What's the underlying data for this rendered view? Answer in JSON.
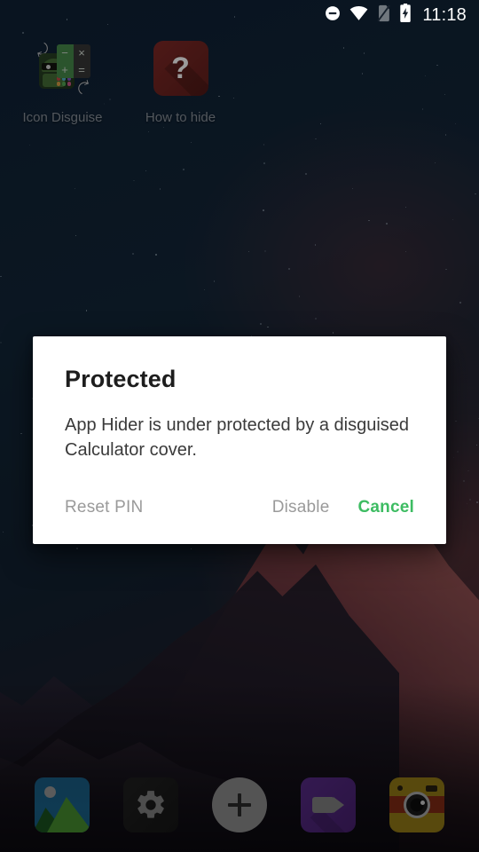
{
  "status_bar": {
    "icons": [
      {
        "name": "do-not-disturb-icon",
        "glyph": "dnd"
      },
      {
        "name": "wifi-icon",
        "glyph": "wifi"
      },
      {
        "name": "no-sim-icon",
        "glyph": "no-sim"
      },
      {
        "name": "battery-charging-icon",
        "glyph": "battery-charging"
      }
    ],
    "time": "11:18"
  },
  "home_screen": {
    "apps": [
      {
        "label": "Icon Disguise",
        "icon": "icon-disguise-calculator-android-icon"
      },
      {
        "label": "How to hide",
        "icon": "question-mark-icon"
      }
    ],
    "icon_disguise_art": {
      "operators": [
        "−",
        "×",
        "+",
        "="
      ],
      "cell_colors": [
        "#4f9a52",
        "#3d3d3d",
        "#4f9a52",
        "#3d3d3d"
      ],
      "arrow_glyph": "➦",
      "dot_colors": [
        "#d9534f",
        "#f0ad4e",
        "#5bc0de",
        "#8e5bd6"
      ]
    },
    "how_to_hide_art": {
      "question_mark": "?",
      "background_color": "#8e2e2b",
      "mark_color": "#9b9b9b"
    }
  },
  "dock": {
    "items": [
      {
        "name": "gallery-icon",
        "label": "Gallery"
      },
      {
        "name": "settings-gear-icon",
        "label": "Settings"
      },
      {
        "name": "add-plus-icon",
        "label": "Add"
      },
      {
        "name": "video-camera-icon",
        "label": "Video"
      },
      {
        "name": "camera-icon",
        "label": "Camera"
      }
    ]
  },
  "dialog": {
    "title": "Protected",
    "message": "App Hider is under protected by a disguised Calculator cover.",
    "buttons": {
      "reset_pin": "Reset PIN",
      "disable": "Disable",
      "cancel": "Cancel"
    },
    "accent_color": "#3dbc62",
    "neutral_color": "#9a9a9a"
  }
}
